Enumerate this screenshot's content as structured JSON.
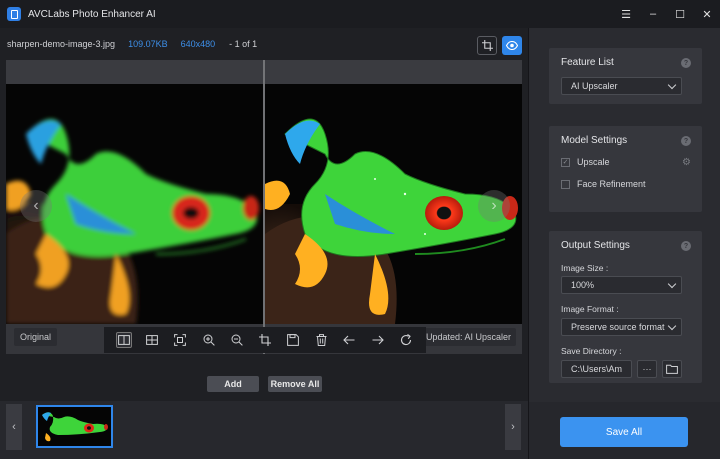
{
  "app": {
    "title": "AVCLabs Photo Enhancer AI"
  },
  "window_controls": {
    "menu": "☰",
    "minimize": "–",
    "maximize": "☐",
    "close": "✕"
  },
  "file_info": {
    "filename": "sharpen-demo-image-3.jpg",
    "size": "109.07KB",
    "dimensions": "640x480",
    "count": "- 1 of 1"
  },
  "viewer": {
    "label_original": "Original",
    "label_updated": "Updated: AI Upscaler"
  },
  "toolbar": {
    "tools": [
      "split-view",
      "compare-view",
      "fit-screen",
      "zoom-in",
      "zoom-out",
      "crop",
      "save",
      "delete",
      "previous",
      "next",
      "rotate"
    ]
  },
  "actions": {
    "add": "Add",
    "remove_all": "Remove All"
  },
  "panel": {
    "feature_list": {
      "title": "Feature List",
      "selected": "AI Upscaler"
    },
    "model_settings": {
      "title": "Model Settings",
      "upscale": {
        "label": "Upscale",
        "checked": true
      },
      "face_refinement": {
        "label": "Face Refinement",
        "checked": false
      }
    },
    "output_settings": {
      "title": "Output Settings",
      "image_size_label": "Image Size :",
      "image_size": "100%",
      "image_format_label": "Image Format :",
      "image_format": "Preserve source format",
      "save_directory_label": "Save Directory :",
      "save_directory": "C:\\Users\\Am",
      "more": "···"
    },
    "save_all": "Save All"
  },
  "colors": {
    "accent": "#2f86ea",
    "background": "#1f2024",
    "panel": "#2a2b30"
  }
}
